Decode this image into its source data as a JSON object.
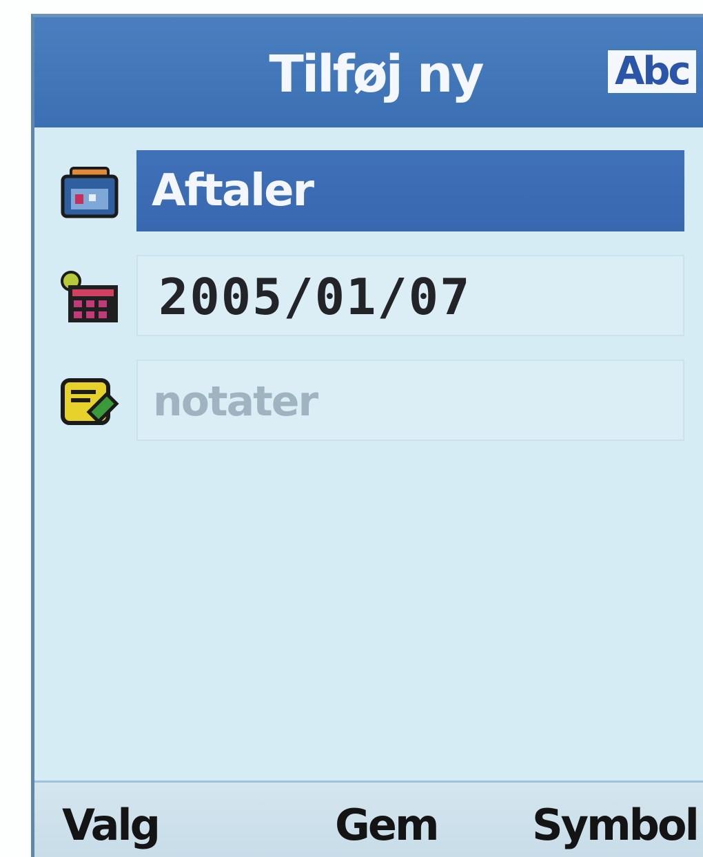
{
  "header": {
    "title": "Tilføj ny",
    "input_mode": "Abc"
  },
  "form": {
    "fields": [
      {
        "icon": "calendar-category-icon",
        "value": "Aftaler",
        "selected": true
      },
      {
        "icon": "date-calendar-icon",
        "value": "2005/01/07",
        "selected": false
      },
      {
        "icon": "note-pencil-icon",
        "placeholder": "notater",
        "selected": false
      }
    ]
  },
  "softkeys": {
    "left": "Valg",
    "center": "Gem",
    "right": "Symbol"
  },
  "colors": {
    "title_bar": "#3a70b3",
    "selection": "#3f71b8",
    "background": "#d6ecf4"
  }
}
